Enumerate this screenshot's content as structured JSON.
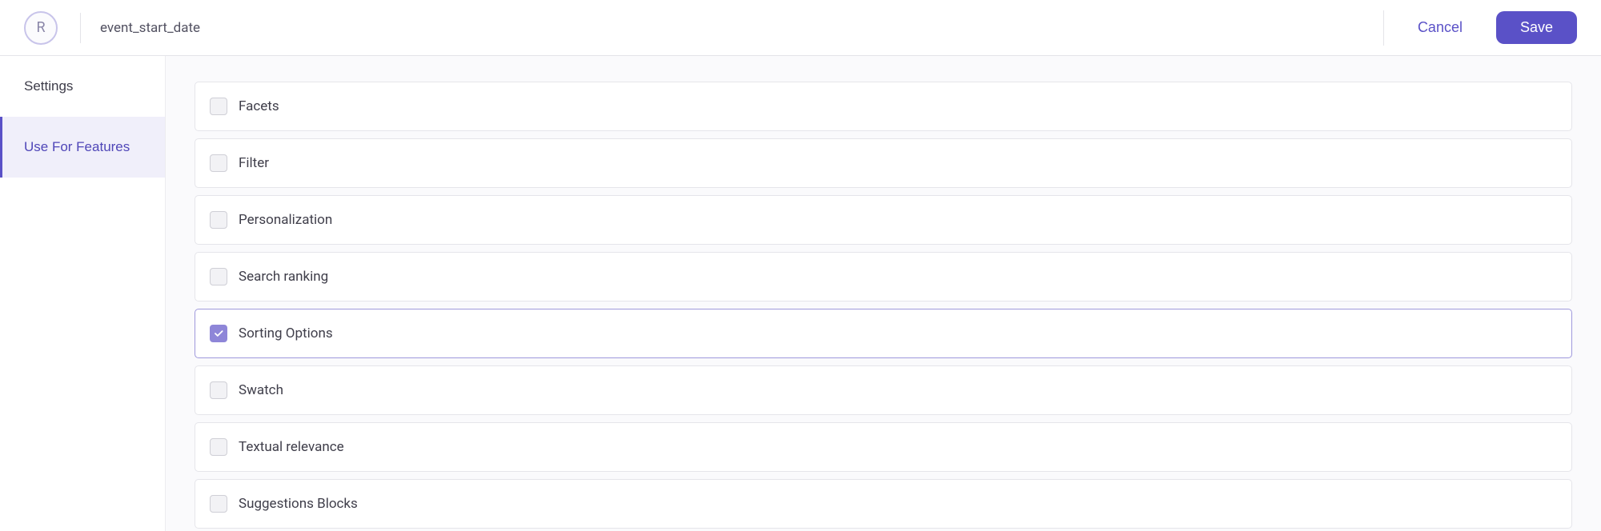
{
  "header": {
    "avatar_initial": "R",
    "title": "event_start_date",
    "cancel_label": "Cancel",
    "save_label": "Save"
  },
  "sidebar": {
    "items": [
      {
        "label": "Settings",
        "active": false
      },
      {
        "label": "Use For Features",
        "active": true
      }
    ]
  },
  "features": [
    {
      "label": "Facets",
      "checked": false
    },
    {
      "label": "Filter",
      "checked": false
    },
    {
      "label": "Personalization",
      "checked": false
    },
    {
      "label": "Search ranking",
      "checked": false
    },
    {
      "label": "Sorting Options",
      "checked": true
    },
    {
      "label": "Swatch",
      "checked": false
    },
    {
      "label": "Textual relevance",
      "checked": false
    },
    {
      "label": "Suggestions Blocks",
      "checked": false
    }
  ]
}
